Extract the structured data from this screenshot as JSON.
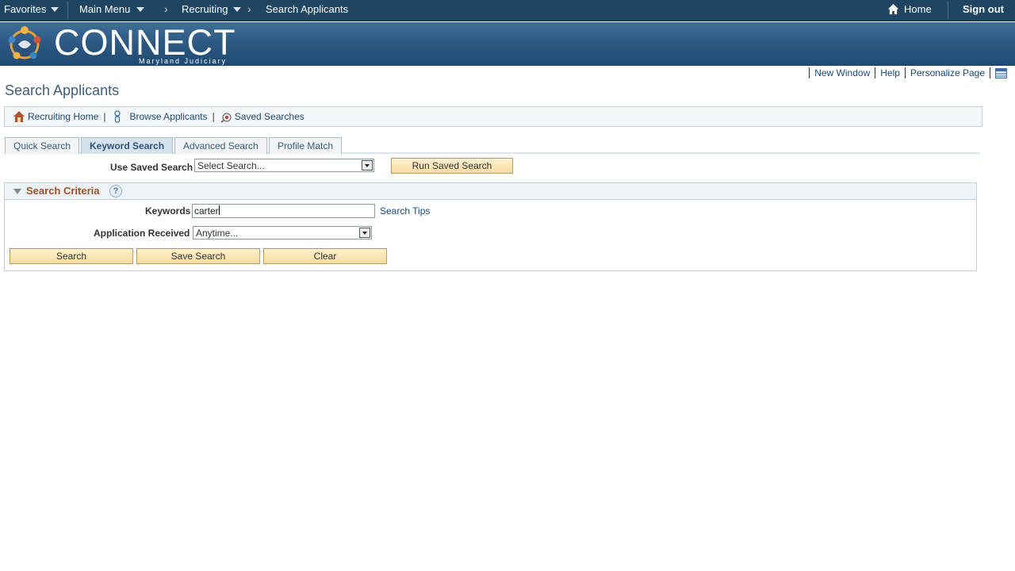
{
  "topbar": {
    "favorites": "Favorites",
    "main_menu": "Main Menu",
    "crumb_recruiting": "Recruiting",
    "crumb_current": "Search Applicants",
    "home": "Home",
    "sign_out": "Sign out"
  },
  "banner": {
    "logo_text": "CONNECT",
    "logo_sub": "Maryland Judiciary"
  },
  "page_links": {
    "new_window": "New Window",
    "help": "Help",
    "personalize": "Personalize Page"
  },
  "page_title": "Search Applicants",
  "nav_links": {
    "recruiting_home": "Recruiting Home",
    "browse_applicants": "Browse Applicants",
    "saved_searches": "Saved Searches",
    "separator": "|"
  },
  "tabs": [
    {
      "label": "Quick Search",
      "active": false
    },
    {
      "label": "Keyword Search",
      "active": true
    },
    {
      "label": "Advanced Search",
      "active": false
    },
    {
      "label": "Profile Match",
      "active": false
    }
  ],
  "saved_search": {
    "label": "Use Saved Search",
    "value": "Select Search...",
    "run_button": "Run Saved Search"
  },
  "criteria": {
    "title": "Search Criteria",
    "help_glyph": "?",
    "keywords_label": "Keywords",
    "keywords_value": "carter",
    "search_tips": "Search Tips",
    "app_received_label": "Application Received",
    "app_received_value": "Anytime...",
    "search_button": "Search",
    "save_search_button": "Save Search",
    "clear_button": "Clear"
  },
  "colors": {
    "topbar": "#1f4563",
    "banner": "#2a5680",
    "link": "#1a4a7c",
    "button": "#f7dca2",
    "group_title": "#a34d24"
  }
}
